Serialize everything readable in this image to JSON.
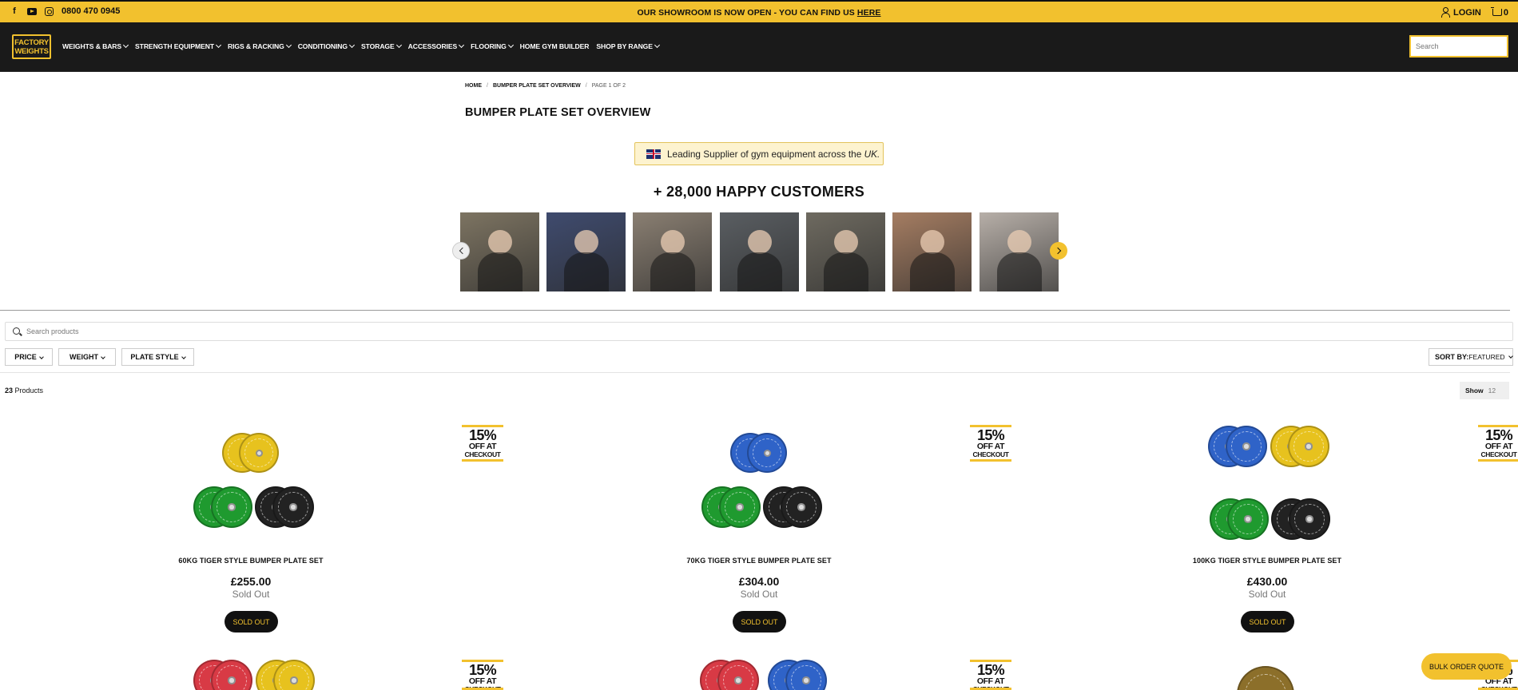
{
  "topbar": {
    "phone": "0800 470 0945",
    "announcement": "OUR SHOWROOM IS NOW OPEN - YOU CAN FIND US",
    "announcement_link": "HERE",
    "login": "LOGIN",
    "cart_count": "0"
  },
  "nav": {
    "logo_line1": "FACTORY",
    "logo_line2": "WEIGHTS",
    "items": [
      {
        "label": "WEIGHTS & BARS",
        "has_dropdown": true
      },
      {
        "label": "STRENGTH EQUIPMENT",
        "has_dropdown": true
      },
      {
        "label": "RIGS & RACKING",
        "has_dropdown": true
      },
      {
        "label": "CONDITIONING",
        "has_dropdown": true
      },
      {
        "label": "STORAGE",
        "has_dropdown": true
      },
      {
        "label": "ACCESSORIES",
        "has_dropdown": true
      },
      {
        "label": "FLOORING",
        "has_dropdown": true
      },
      {
        "label": "HOME GYM BUILDER",
        "has_dropdown": false
      },
      {
        "label": "SHOP BY RANGE",
        "has_dropdown": true
      }
    ],
    "search_placeholder": "Search"
  },
  "breadcrumb": {
    "home": "HOME",
    "sep": "/",
    "section": "BUMPER PLATE SET OVERVIEW",
    "page": "PAGE 1 OF 2"
  },
  "page_title": "BUMPER PLATE SET OVERVIEW",
  "supplier_text": "Leading Supplier of gym equipment across the",
  "supplier_uk": "UK.",
  "happy_customers": "+ 28,000 HAPPY CUSTOMERS",
  "customer_thumbs": [
    {
      "icon": "gym-photo-1",
      "bg": "#7d7462"
    },
    {
      "icon": "gym-photo-2",
      "bg": "#3f4b6e"
    },
    {
      "icon": "gym-photo-3",
      "bg": "#8a7f72"
    },
    {
      "icon": "gym-photo-4",
      "bg": "#5a5e62"
    },
    {
      "icon": "gym-photo-5",
      "bg": "#6e6a60"
    },
    {
      "icon": "gym-photo-6",
      "bg": "#a57d62"
    },
    {
      "icon": "gym-photo-7",
      "bg": "#b7afa8"
    }
  ],
  "filters": {
    "search_placeholder": "Search products",
    "buttons": [
      "PRICE",
      "WEIGHT",
      "PLATE STYLE"
    ],
    "sort_label": "SORT BY:",
    "sort_value": "FEATURED"
  },
  "product_count": "23",
  "product_count_label": "Products",
  "show_label": "Show",
  "show_value": "12",
  "promo_badge": {
    "line1": "15%",
    "line2": "OFF AT",
    "line3": "CHECKOUT"
  },
  "products": [
    {
      "title": "60KG TIGER STYLE BUMPER PLATE SET",
      "price": "£255.00",
      "status": "Sold Out",
      "button": "SOLD OUT"
    },
    {
      "title": "70KG TIGER STYLE BUMPER PLATE SET",
      "price": "£304.00",
      "status": "Sold Out",
      "button": "SOLD OUT"
    },
    {
      "title": "100KG TIGER STYLE BUMPER PLATE SET",
      "price": "£430.00",
      "status": "Sold Out",
      "button": "SOLD OUT"
    }
  ],
  "bulk_quote": "BULK ORDER QUOTE",
  "colors": {
    "accent": "#f2c12e",
    "nav_bg": "#1a1a1a",
    "plate_yellow": "#e7c21e",
    "plate_green": "#1f9a2f",
    "plate_black": "#222222",
    "plate_blue": "#2f63c8",
    "plate_red": "#d83a45",
    "plate_camo": "#8c6f2a"
  }
}
